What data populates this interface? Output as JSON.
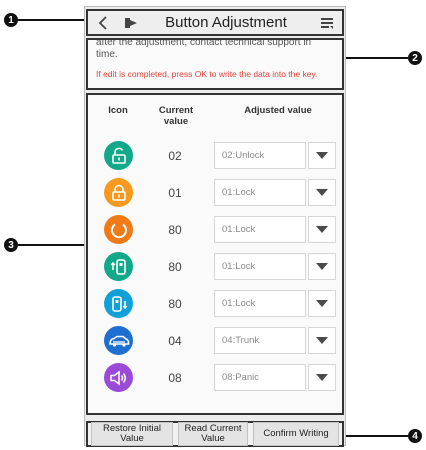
{
  "callouts": [
    "1",
    "2",
    "3",
    "4"
  ],
  "header": {
    "title": "Button Adjustment",
    "back_icon": "chevron-left-icon",
    "exit_icon": "exit-icon",
    "menu_icon": "list-menu-icon"
  },
  "notice": {
    "gray_text": "after the adjustment, contact technical support in time.",
    "red_text": "If edit is completed, press OK to write the data into the key."
  },
  "table": {
    "col_icon": "Icon",
    "col_current": "Current value",
    "col_adjusted": "Adjusted value",
    "rows": [
      {
        "icon": "unlock-icon",
        "color": "#12a88a",
        "current": "02",
        "adjusted": "02:Unlock"
      },
      {
        "icon": "lock-icon",
        "color": "#f59a1f",
        "current": "01",
        "adjusted": "01:Lock"
      },
      {
        "icon": "ring-icon",
        "color": "#f07a16",
        "current": "80",
        "adjusted": "01:Lock"
      },
      {
        "icon": "key-fob-up-icon",
        "color": "#12a88a",
        "current": "80",
        "adjusted": "01:Lock"
      },
      {
        "icon": "key-fob-down-icon",
        "color": "#12a0d8",
        "current": "80",
        "adjusted": "01:Lock"
      },
      {
        "icon": "trunk-icon",
        "color": "#1f6fd0",
        "current": "04",
        "adjusted": "04:Trunk"
      },
      {
        "icon": "panic-icon",
        "color": "#9b4ad8",
        "current": "08",
        "adjusted": "08:Panic"
      }
    ]
  },
  "footer": {
    "restore_label": "Restore Initial Value",
    "read_label": "Read Current Value",
    "confirm_label": "Confirm Writing"
  }
}
